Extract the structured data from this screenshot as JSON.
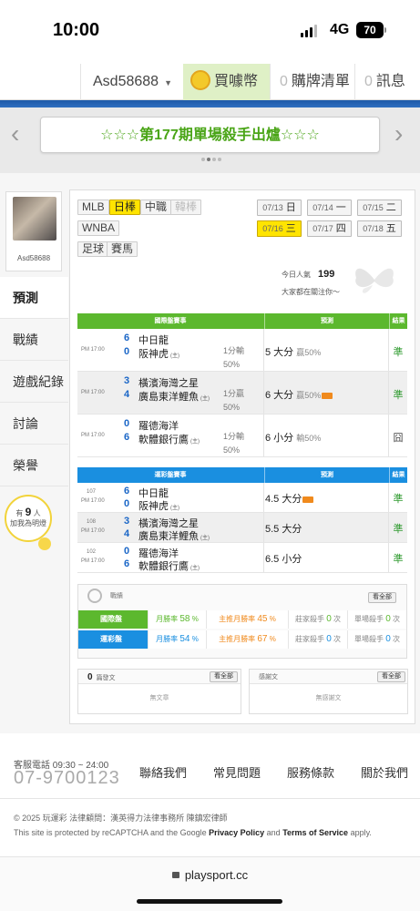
{
  "status": {
    "time": "10:00",
    "network": "4G",
    "battery": "70"
  },
  "topnav": {
    "user": "Asd58688",
    "buy_coins_icon": "coin-icon",
    "buy_coins": "買噱幣",
    "cart_count": "0",
    "cart": "購牌清單",
    "msg_count": "0",
    "msg": "訊息"
  },
  "banner": {
    "text": "☆☆☆第177期單場殺手出爐☆☆☆",
    "prev": "‹",
    "next": "›"
  },
  "sidebar": {
    "username": "Asd58688",
    "items": [
      "預測",
      "戰績",
      "遊戲紀錄",
      "討論",
      "榮譽"
    ],
    "fans_prefix": "有",
    "fans_count": "9",
    "fans_unit": "人",
    "fans_text": "加我為明燈"
  },
  "leagues": [
    "MLB",
    "日棒",
    "中職",
    "韓棒",
    "WNBA",
    "足球",
    "賽馬"
  ],
  "dates": [
    {
      "md": "07/13",
      "wd": "日"
    },
    {
      "md": "07/14",
      "wd": "一"
    },
    {
      "md": "07/15",
      "wd": "二"
    },
    {
      "md": "07/16",
      "wd": "三"
    },
    {
      "md": "07/17",
      "wd": "四"
    },
    {
      "md": "07/18",
      "wd": "五"
    }
  ],
  "popularity": {
    "label": "今日人氣",
    "value": "199",
    "watching": "大家都在關注你～"
  },
  "intl": {
    "header": {
      "c1": "國際盤賽事",
      "c2": "預測",
      "c3": "結果"
    },
    "color": "#5cb82e",
    "rows": [
      {
        "time": "PM 17:00",
        "s1": "6",
        "t1": "中日龍",
        "s2": "0",
        "t2": "阪神虎",
        "mark": "(主)",
        "hc": "1分輸 50%",
        "pred": "5 大分",
        "sub": "贏50%",
        "hot": false,
        "res": "準"
      },
      {
        "time": "PM 17:00",
        "s1": "3",
        "t1": "橫濱海灣之星",
        "s2": "4",
        "t2": "廣島東洋鯉魚",
        "mark": "(主)",
        "hc": "1分贏 50%",
        "pred": "6 大分",
        "sub": "贏50%",
        "hot": true,
        "res": "準"
      },
      {
        "time": "PM 17:00",
        "s1": "0",
        "t1": "羅德海洋",
        "s2": "6",
        "t2": "軟體銀行鷹",
        "mark": "(主)",
        "hc": "1分輸 50%",
        "pred": "6 小分",
        "sub": "輸50%",
        "hot": false,
        "res": "囧"
      }
    ]
  },
  "lottery": {
    "header": {
      "c1": "運彩盤賽事",
      "c2": "預測",
      "c3": "結果"
    },
    "color": "#1a8fe0",
    "rows": [
      {
        "no": "107",
        "time": "PM 17:00",
        "s1": "6",
        "t1": "中日龍",
        "s2": "0",
        "t2": "阪神虎",
        "mark": "(主)",
        "pred": "4.5 大分",
        "hot": true,
        "res": "準"
      },
      {
        "no": "108",
        "time": "PM 17:00",
        "s1": "3",
        "t1": "橫濱海灣之星",
        "s2": "4",
        "t2": "廣島東洋鯉魚",
        "mark": "(主)",
        "pred": "5.5 大分",
        "hot": false,
        "res": "準"
      },
      {
        "no": "102",
        "time": "PM 17:00",
        "s1": "0",
        "t1": "羅德海洋",
        "s2": "6",
        "t2": "軟體銀行鷹",
        "mark": "(主)",
        "pred": "6.5 小分",
        "hot": false,
        "res": "準"
      }
    ]
  },
  "record": {
    "label": "戰績",
    "all": "看全部",
    "rows": [
      {
        "tag": "國際盤",
        "m_label": "月勝率",
        "m_val": "58",
        "p_label": "主推月勝率",
        "p_val": "45",
        "k_label": "莊家殺手",
        "k_val": "0",
        "s_label": "單場殺手",
        "s_val": "0",
        "unit": "%",
        "times": "次"
      },
      {
        "tag": "運彩盤",
        "m_label": "月勝率",
        "m_val": "54",
        "p_label": "主推月勝率",
        "p_val": "67",
        "k_label": "莊家殺手",
        "k_val": "0",
        "s_label": "單場殺手",
        "s_val": "0",
        "unit": "%",
        "times": "次"
      }
    ]
  },
  "posts": {
    "count": "0",
    "label": "篇發文",
    "all": "看全部",
    "empty": "無文章"
  },
  "thanks": {
    "label": "感謝文",
    "all": "看全部",
    "empty": "無感謝文"
  },
  "footer": {
    "phone_label": "客服電話 09:30 ~ 24:00",
    "phone": "07-9700123",
    "links": [
      "聯絡我們",
      "常見問題",
      "服務條款",
      "關於我們"
    ],
    "copyright": "© 2025 玩運彩 法律顧問：漢英得力法律事務所 陳鎮宏律師",
    "captcha_pre": "This site is protected by reCAPTCHA and the Google ",
    "privacy": "Privacy Policy",
    "and": " and ",
    "terms": "Terms of Service",
    "apply": " apply."
  },
  "url": "playsport.cc"
}
